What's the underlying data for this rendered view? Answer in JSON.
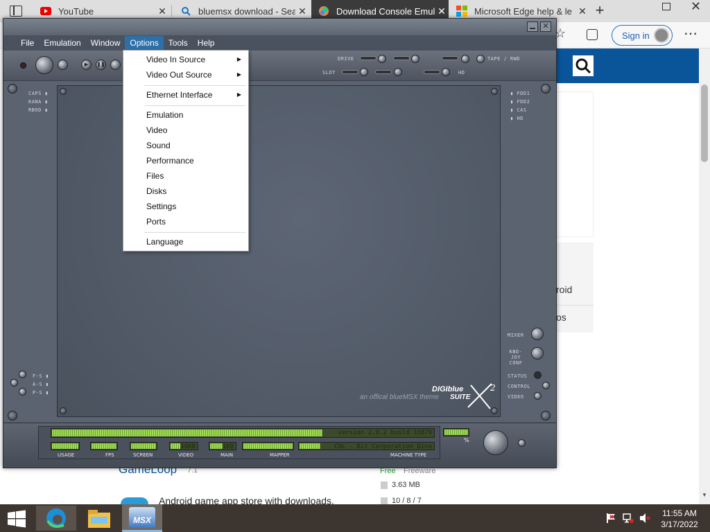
{
  "browser": {
    "tabs": [
      {
        "label": "YouTube",
        "icon": "youtube-icon",
        "active": false
      },
      {
        "label": "bluemsx download - Sear",
        "icon": "search-icon",
        "active": false
      },
      {
        "label": "Download Console Emul",
        "icon": "colorful-logo-icon",
        "active": true
      },
      {
        "label": "Microsoft Edge help & le",
        "icon": "microsoft-icon",
        "active": false
      }
    ],
    "new_tab": "+",
    "sign_in": "Sign in",
    "more": "⋯"
  },
  "page": {
    "right_items": [
      "roid",
      "os"
    ],
    "app_name": "GameLoop",
    "app_version": "7.1",
    "app_desc": "Android game app store with downloads.",
    "license_label": "Free",
    "license_type": "Freeware",
    "size": "3.63 MB",
    "os": "10 / 8 / 7"
  },
  "emulator": {
    "menu": [
      "File",
      "Emulation",
      "Window",
      "Options",
      "Tools",
      "Help"
    ],
    "open_menu": "Options",
    "toolbar_labels": {
      "drive": "DRIVE",
      "slot": "SLOT",
      "tape": "TAPE / RWD",
      "hd": "HD"
    },
    "left_leds": [
      "CAPS",
      "KANA",
      "RBOD"
    ],
    "left_switches": [
      "F-S",
      "A-S",
      "P-S"
    ],
    "right_leds": [
      "FDD1",
      "FDD2",
      "CAS",
      "HD"
    ],
    "right_controls": [
      "MIXER",
      "KBD-JOY CONF",
      "STATUS",
      "CONTROL",
      "VIDEO"
    ],
    "logo_line1": "DIGIblue",
    "logo_line2": "SUITE",
    "logo_tagline": "an offical blueMSX theme",
    "version_text": "version 2.8.2  build 33879",
    "machine_text": "COL - Bit Corporation Dina",
    "video_value": "16KB",
    "main_value": "1KB",
    "stat_labels": [
      "USAGE",
      "FPS",
      "SCREEN",
      "VIDEO",
      "MAIN",
      "MAPPER",
      "MACHINE TYPE"
    ],
    "percent_label": "%"
  },
  "options_menu": {
    "items": [
      {
        "label": "Video In Source",
        "submenu": true
      },
      {
        "label": "Video Out Source",
        "submenu": true
      },
      {
        "label": "Ethernet Interface",
        "submenu": true
      },
      {
        "label": "Emulation",
        "submenu": false
      },
      {
        "label": "Video",
        "submenu": false
      },
      {
        "label": "Sound",
        "submenu": false
      },
      {
        "label": "Performance",
        "submenu": false
      },
      {
        "label": "Files",
        "submenu": false
      },
      {
        "label": "Disks",
        "submenu": false
      },
      {
        "label": "Settings",
        "submenu": false
      },
      {
        "label": "Ports",
        "submenu": false
      },
      {
        "label": "Language",
        "submenu": false
      }
    ]
  },
  "taskbar": {
    "apps": [
      "edge-icon",
      "file-explorer-icon",
      "bluemsx-icon"
    ],
    "msx_label": "MSX",
    "time": "11:55 AM",
    "date": "3/17/2022"
  },
  "colors": {
    "accent": "#2d6fa6",
    "taskbar": "#3d3530",
    "lcd_green": "#9fdb52",
    "page_header": "#0a5499"
  }
}
